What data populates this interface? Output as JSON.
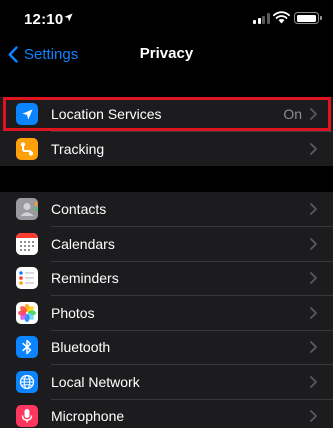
{
  "status_bar": {
    "time": "12:10"
  },
  "nav": {
    "back_label": "Settings",
    "title": "Privacy"
  },
  "group1": [
    {
      "label": "Location Services",
      "value": "On",
      "icon": "location-arrow-icon",
      "color": "#0a84ff"
    },
    {
      "label": "Tracking",
      "icon": "tracking-icon",
      "color": "#ff9f0a"
    }
  ],
  "group2": [
    {
      "label": "Contacts",
      "icon": "contacts-icon",
      "color": "#8e8e93"
    },
    {
      "label": "Calendars",
      "icon": "calendar-icon",
      "color": "#ffffff"
    },
    {
      "label": "Reminders",
      "icon": "reminders-icon",
      "color": "#ffffff"
    },
    {
      "label": "Photos",
      "icon": "photos-icon",
      "color": "#ffffff"
    },
    {
      "label": "Bluetooth",
      "icon": "bluetooth-icon",
      "color": "#0a84ff"
    },
    {
      "label": "Local Network",
      "icon": "globe-icon",
      "color": "#0a84ff"
    },
    {
      "label": "Microphone",
      "icon": "microphone-icon",
      "color": "#ff375f"
    }
  ],
  "colors": {
    "accent": "#0a84ff",
    "highlight_box": "#e0141e",
    "cell_bg": "#1c1c1e",
    "separator": "#38383a"
  }
}
